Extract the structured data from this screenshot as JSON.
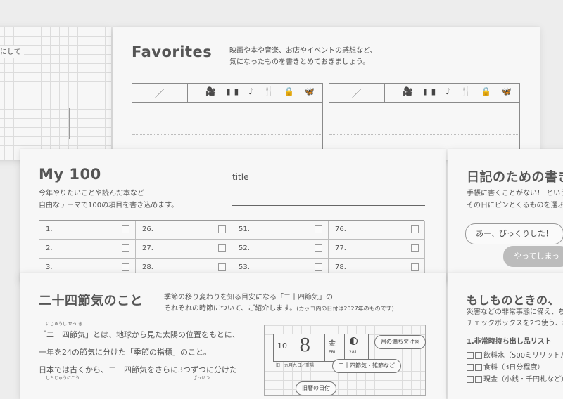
{
  "left_page": {
    "text": "にして"
  },
  "favorites": {
    "title": "Favorites",
    "desc_line1": "映画や本や音楽、お店やイベントの感想など、",
    "desc_line2": "気になったものを書きとめておきましょう。",
    "slash": "／",
    "icons_label": "🎥 ▮▮ ♪ 🍴 🔒 🦋"
  },
  "my100": {
    "title": "My 100",
    "desc_line1": "今年やりたいことや読んだ本など",
    "desc_line2": "自由なテーマで100の項目を書き込めます。",
    "title_label": "title",
    "columns": [
      [
        "1.",
        "2.",
        "3."
      ],
      [
        "26.",
        "27.",
        "28."
      ],
      [
        "51.",
        "52.",
        "53."
      ],
      [
        "76.",
        "77.",
        "78."
      ]
    ]
  },
  "diary": {
    "title": "日記のための書き",
    "desc_line1": "手帳に書くことがない！ という",
    "desc_line2": "その日にピンとくるものを選ぶ",
    "pill1": "あー、びっくりした！",
    "pill2": "やってしまっ"
  },
  "sekki": {
    "title": "二十四節気のこと",
    "desc_line1": "季節の移り変わりを知る目安になる「二十四節気」の",
    "desc_line2": "それぞれの時節について、ご紹介します。",
    "desc_note": "(カッコ内の日付は2027年のものです)",
    "ruby1": "にじゅうし せっ き",
    "body_line1": "「二十四節気」とは、地球から見た太陽の位置をもとに、",
    "body_line2": "一年を24の節気に分けた「季節の指標」のこと。",
    "body_line3": "日本では古くから、二十四節気をさらに3つずつに分けた",
    "ruby2": "しちじゅうにこう",
    "ruby3": "ざっせつ",
    "calendar": {
      "month": "10",
      "day": "8",
      "weekday": "金",
      "weekday_en": "FRI",
      "moon_num": "281",
      "bottom_text": "旧：九月九日／重陽",
      "bubble1": "月の満ち欠け※",
      "bubble2": "二十四節気・雑節など",
      "bubble3": "旧暦の日付"
    }
  },
  "emergency": {
    "title": "もしものときの、",
    "desc_line1": "災害などの非常事態に備え、ち",
    "desc_line2": "チェックボックスを2つ使う、年",
    "list_title": "1.非常時持ち出し品リスト",
    "items": [
      "飲料水（500ミリリットル",
      "食料（3日分程度）",
      "現金（小銭・千円札など）"
    ]
  }
}
